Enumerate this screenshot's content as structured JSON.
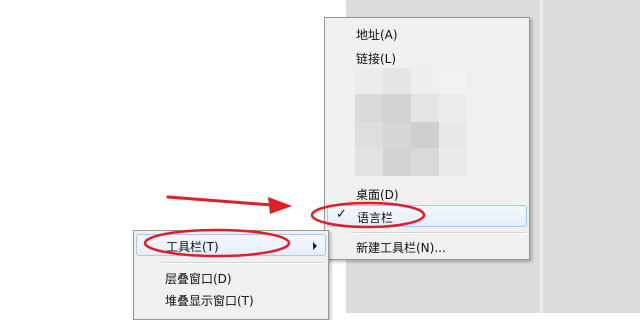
{
  "toolbar_submenu": {
    "items": [
      {
        "label": "地址(A)"
      },
      {
        "label": "链接(L)"
      },
      {
        "label": "桌面(D)"
      },
      {
        "label": "语言栏",
        "checked": true,
        "check_glyph": "✓"
      },
      {
        "label": "新建工具栏(N)..."
      }
    ]
  },
  "context_menu": {
    "items": [
      {
        "label": "工具栏(T)",
        "has_submenu": true
      },
      {
        "label": "层叠窗口(D)"
      },
      {
        "label": "堆叠显示窗口(T)"
      }
    ]
  },
  "annotation": {
    "highlight_color": "#e11d25",
    "arrow_icon": "red-arrow-icon"
  }
}
